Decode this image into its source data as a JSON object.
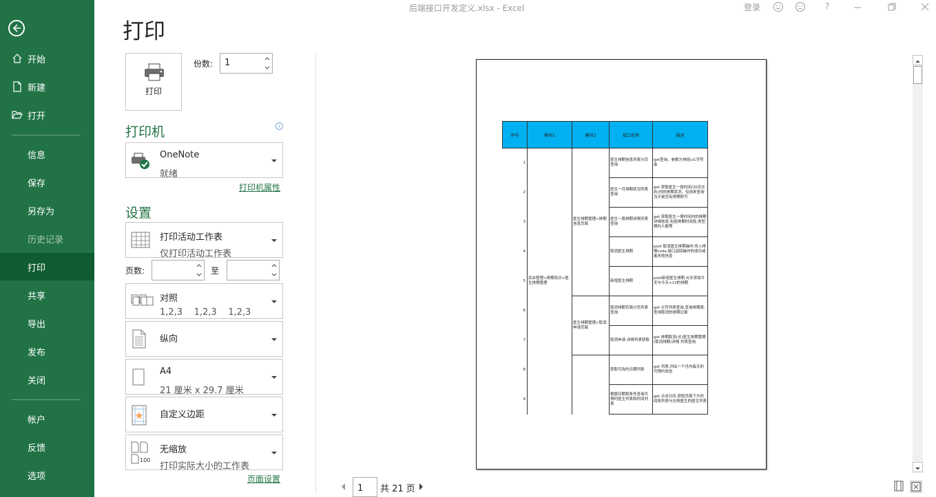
{
  "titlebar": {
    "doc_title": "后端接口开发定义.xlsx  -  Excel",
    "login": "登录",
    "help": "?"
  },
  "sidebar": {
    "items": [
      {
        "label": "开始",
        "icon": "home-icon"
      },
      {
        "label": "新建",
        "icon": "new-doc-icon"
      },
      {
        "label": "打开",
        "icon": "folder-open-icon"
      },
      {
        "label": "信息"
      },
      {
        "label": "保存"
      },
      {
        "label": "另存为"
      },
      {
        "label": "历史记录"
      },
      {
        "label": "打印"
      },
      {
        "label": "共享"
      },
      {
        "label": "导出"
      },
      {
        "label": "发布"
      },
      {
        "label": "关闭"
      },
      {
        "label": "帐户"
      },
      {
        "label": "反馈"
      },
      {
        "label": "选项"
      }
    ],
    "active": "打印"
  },
  "print": {
    "heading": "打印",
    "print_button": "打印",
    "copies_label": "份数:",
    "copies_value": "1",
    "printer_title": "打印机",
    "printer_name": "OneNote",
    "printer_status": "就绪",
    "printer_props": "打印机属性",
    "settings_title": "设置",
    "scope_main": "打印活动工作表",
    "scope_sub": "仅打印活动工作表",
    "pages_label": "页数:",
    "pages_to": "至",
    "collate_main": "对照",
    "collate_sub": "1,2,3    1,2,3    1,2,3",
    "orientation": "纵向",
    "paper_main": "A4",
    "paper_sub": "21 厘米 x 29.7 厘米",
    "margins": "自定义边距",
    "scaling_main": "无缩放",
    "scaling_sub": "打印实际大小的工作表",
    "page_setup": "页面设置"
  },
  "preview": {
    "current_page": "1",
    "total_pages": "共 21 页",
    "sheet": {
      "headers": [
        "序号",
        "模块1",
        "模块2",
        "接口名称",
        "描述"
      ],
      "rows": [
        {
          "num": "1",
          "name": "医生排期信息列表分页查询",
          "desc": "get查询，参数为排班ui1字符串"
        },
        {
          "num": "2",
          "name": "医生一月排期状况列表查询",
          "desc": "get 获取医生一段时间(30天左右)内的排期状况，仅用来查询当天是否有排期即可"
        },
        {
          "num": "3",
          "name": "医生一周排期详情列表查询",
          "desc": "get 获取医生一周时间内的排期详细信息,包括排期时间段,类型,预约人数等"
        },
        {
          "num": "4",
          "name": "取消医生排期",
          "desc": "post 取消医生排期操作,传入排期code,接口返回操作的成功或者失败信息"
        },
        {
          "num": "5",
          "name": "新增医生排期",
          "desc": "post新增医生排期,允许添加今天与今天+13的排期"
        },
        {
          "num": "6",
          "name": "取消排期页面分页列表查询",
          "desc": "get 分页列表查询,查询排期表,查询取消的排期记录"
        },
        {
          "num": "7",
          "name": "取消申请-详情列表获取",
          "desc": "get 排期取消(诊)医生排期管理(取消排期)详情 列表查询"
        },
        {
          "num": "8",
          "name": "获取可改约日期列表",
          "desc": "get 列表,列出一个月内每天的可预约状态"
        },
        {
          "num": "9",
          "name": "根据日期和条件查询可预约医生列表和时间列表",
          "desc": "get 点击日历,获取页面下方时间段列表与左侧医生的医生列表"
        }
      ],
      "module1_merged": "后台管理>排期改诊>医生排期管理",
      "module2_group1": "医生排期管理>排期信息页面",
      "module2_group2": "医生排期管理>取消申请页面"
    }
  }
}
